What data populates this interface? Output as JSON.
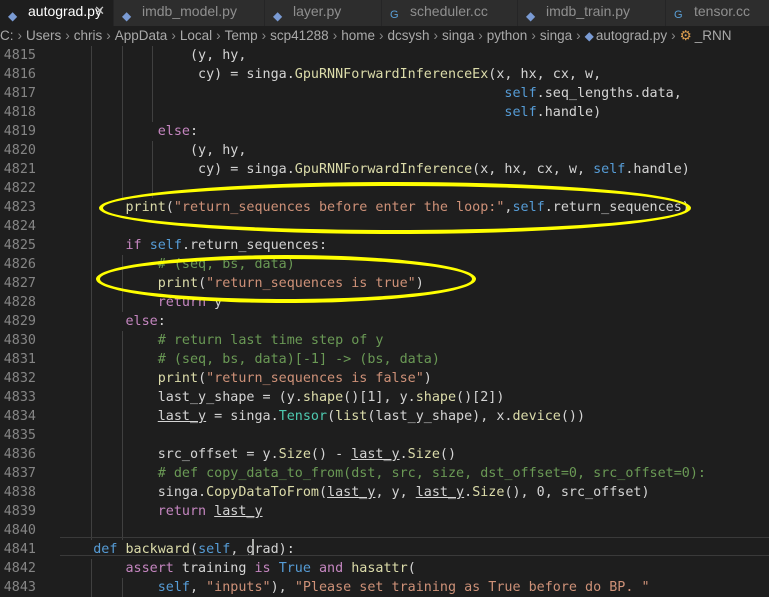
{
  "tabs": [
    {
      "label": "autograd.py",
      "icon": "python-file-icon",
      "active": true,
      "close": "✕"
    },
    {
      "label": "imdb_model.py",
      "icon": "python-file-icon",
      "active": false
    },
    {
      "label": "layer.py",
      "icon": "python-file-icon",
      "active": false
    },
    {
      "label": "scheduler.cc",
      "icon": "cpp-file-icon",
      "active": false
    },
    {
      "label": "imdb_train.py",
      "icon": "python-file-icon",
      "active": false
    },
    {
      "label": "tensor.cc",
      "icon": "cpp-file-icon",
      "active": false
    }
  ],
  "breadcrumb": [
    "C:",
    "Users",
    "chris",
    "AppData",
    "Local",
    "Temp",
    "scp41288",
    "home",
    "dcsysh",
    "singa",
    "python",
    "singa",
    "autograd.py",
    "_RNN"
  ],
  "editor": {
    "line_numbers": [
      "4815",
      "4816",
      "4817",
      "4818",
      "4819",
      "4820",
      "4821",
      "4822",
      "4823",
      "4824",
      "4825",
      "4826",
      "4827",
      "4828",
      "4829",
      "4830",
      "4831",
      "4832",
      "4833",
      "4834",
      "4835",
      "4836",
      "4837",
      "4838",
      "4839",
      "4840",
      "4841",
      "4842",
      "4843"
    ],
    "lines": [
      "                (y, hy,",
      "                 cy) = singa.GpuRNNForwardInferenceEx(x, hx, cx, w,",
      "                                                       self.seq_lengths.data,",
      "                                                       self.handle)",
      "            else:",
      "                (y, hy,",
      "                 cy) = singa.GpuRNNForwardInference(x, hx, cx, w, self.handle)",
      "",
      "        print(\"return_sequences before enter the loop:\",self.return_sequences)",
      "",
      "        if self.return_sequences:",
      "            # (seq, bs, data)",
      "            print(\"return_sequences is true\")",
      "            return y",
      "        else:",
      "            # return last time step of y",
      "            # (seq, bs, data)[-1] -> (bs, data)",
      "            print(\"return_sequences is false\")",
      "            last_y_shape = (y.shape()[1], y.shape()[2])",
      "            last_y = singa.Tensor(list(last_y_shape), x.device())",
      "",
      "            src_offset = y.Size() - last_y.Size()",
      "            # def copy_data_to_from(dst, src, size, dst_offset=0, src_offset=0):",
      "            singa.CopyDataToFrom(last_y, y, last_y.Size(), 0, src_offset)",
      "            return last_y",
      "",
      "    def backward(self, grad):",
      "        assert training is True and hasattr(",
      "            self, \"inputs\"), \"Please set training as True before do BP. \""
    ]
  },
  "annotations": {
    "highlight_color": "#ffff00"
  }
}
